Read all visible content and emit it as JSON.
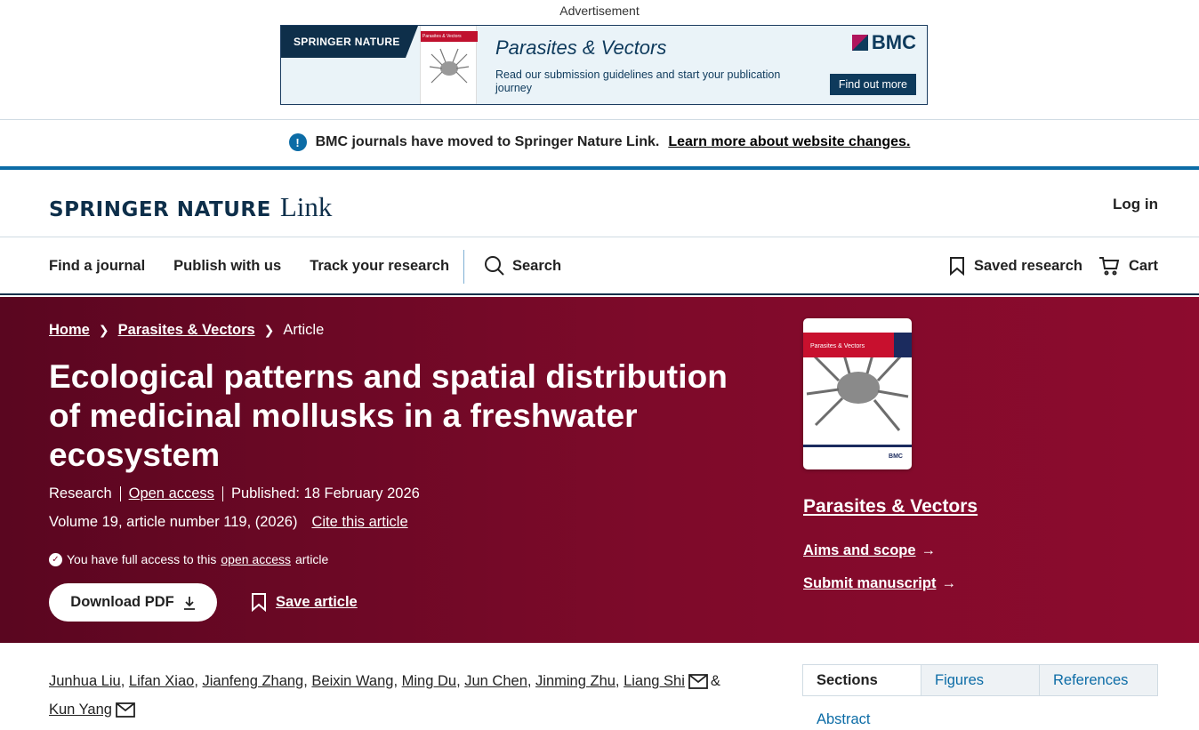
{
  "advertisement": {
    "label": "Advertisement",
    "publisher": "SPRINGER NATURE",
    "journal_title": "Parasites & Vectors",
    "cover_label": "Parasites & Vectors",
    "text": "Read our submission guidelines and start your publication journey",
    "brand": "BMC",
    "button": "Find out more"
  },
  "notice": {
    "text": "BMC journals have moved to Springer Nature Link.",
    "link": "Learn more about website changes."
  },
  "header": {
    "logo_main": "SPRINGER NATURE",
    "logo_link": "Link",
    "login": "Log in"
  },
  "nav": {
    "items": [
      "Find a journal",
      "Publish with us",
      "Track your research"
    ],
    "search": "Search",
    "saved": "Saved research",
    "cart": "Cart"
  },
  "breadcrumb": [
    "Home",
    "Parasites & Vectors",
    "Article"
  ],
  "article": {
    "title": "Ecological patterns and spatial distribution of medicinal mollusks in a freshwater ecosystem",
    "type": "Research",
    "access": "Open access",
    "published": "Published: 18 February 2026",
    "volume": "Volume 19, article number 119, (2026)",
    "cite": "Cite this article",
    "access_note_pre": "You have full access to this",
    "access_note_link": "open access",
    "access_note_post": "article",
    "download": "Download PDF",
    "save": "Save article"
  },
  "journal": {
    "name": "Parasites & Vectors",
    "cover_label": "Parasites & Vectors",
    "cover_brand": "BMC",
    "links": [
      "Aims and scope",
      "Submit manuscript"
    ]
  },
  "authors": [
    "Junhua Liu",
    "Lifan Xiao",
    "Jianfeng Zhang",
    "Beixin Wang",
    "Ming Du",
    "Jun Chen",
    "Jinming Zhu",
    "Liang Shi",
    "Kun Yang"
  ],
  "authors_conjunction": "&",
  "tabs": [
    "Sections",
    "Figures",
    "References"
  ],
  "sections": {
    "first": "Abstract"
  },
  "colors": {
    "hero": "#7e0a2a",
    "accent": "#0c6ca6",
    "brand_dark": "#0e2f4a"
  }
}
